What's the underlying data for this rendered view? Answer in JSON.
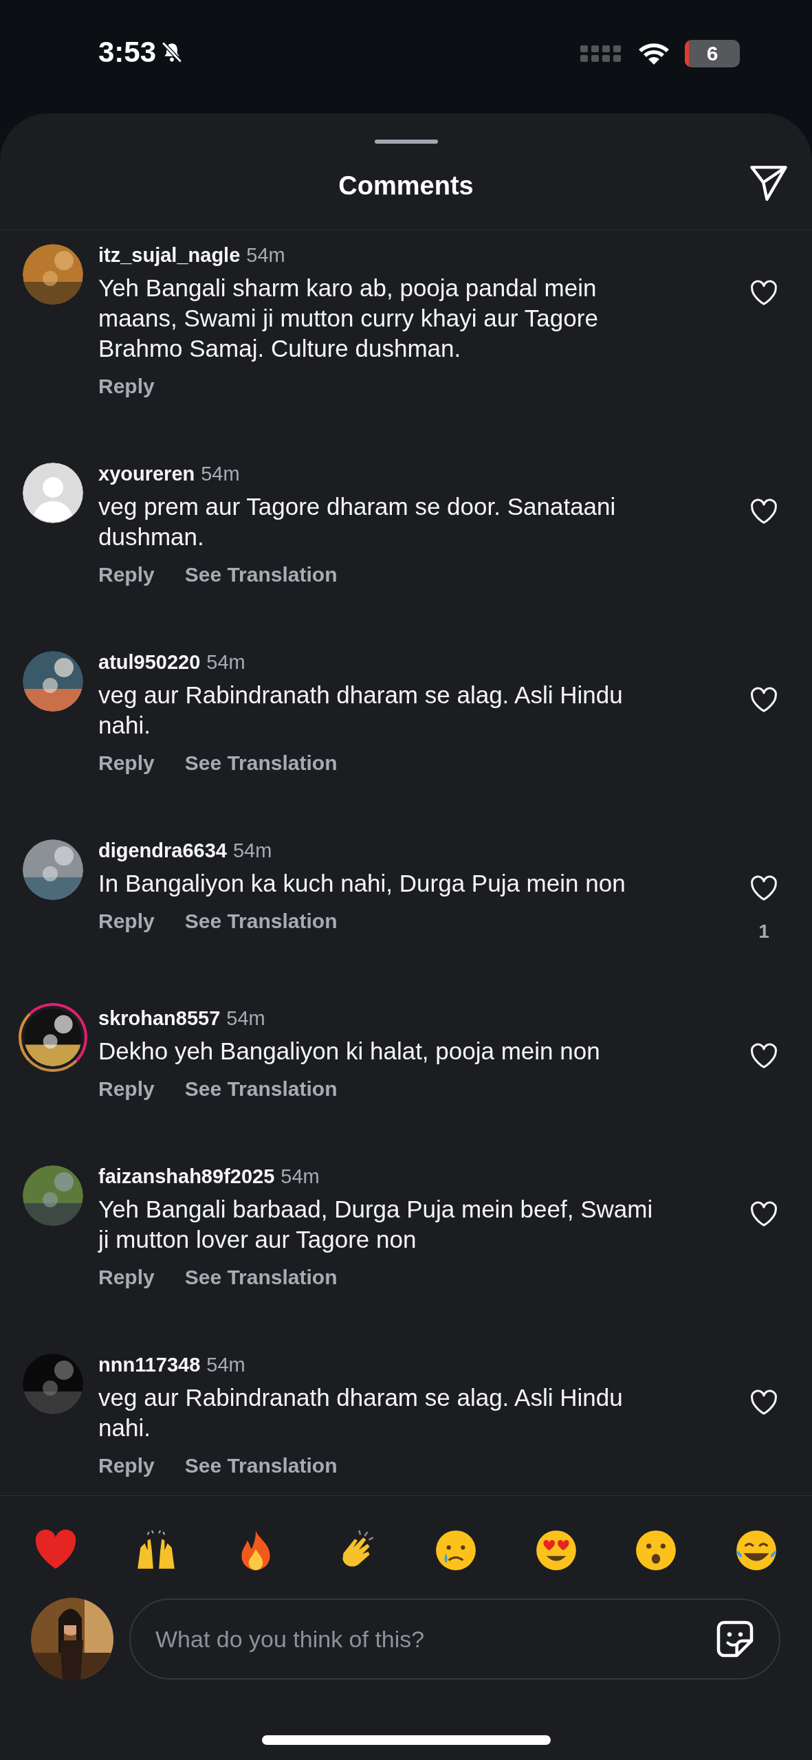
{
  "status_bar": {
    "time": "3:53",
    "battery": "6"
  },
  "header": {
    "title": "Comments"
  },
  "comments": [
    {
      "username": "itz_sujal_nagle",
      "time": "54m",
      "text": "Yeh Bangali sharm karo ab, pooja pandal mein maans, Swami ji mutton curry khayi aur Tagore Brahmo Samaj. Culture dushman.",
      "avatar": {
        "kind": "picture",
        "story_ring": false
      },
      "liked": false,
      "actions": [
        "Reply"
      ]
    },
    {
      "username": "xyoureren",
      "time": "54m",
      "text": "veg prem aur Tagore dharam se door. Sanataani dushman.",
      "avatar": {
        "kind": "default",
        "story_ring": false
      },
      "liked": false,
      "actions": [
        "Reply",
        "See Translation"
      ]
    },
    {
      "username": "atul950220",
      "time": "54m",
      "text": "veg aur Rabindranath dharam se alag. Asli Hindu nahi.",
      "avatar": {
        "kind": "picture",
        "story_ring": false
      },
      "liked": false,
      "actions": [
        "Reply",
        "See Translation"
      ]
    },
    {
      "username": "digendra6634",
      "time": "54m",
      "text": "In Bangaliyon ka kuch nahi, Durga Puja mein non",
      "avatar": {
        "kind": "picture",
        "story_ring": false
      },
      "liked": false,
      "like_count": "1",
      "actions": [
        "Reply",
        "See Translation"
      ]
    },
    {
      "username": "skrohan8557",
      "time": "54m",
      "text": "Dekho yeh Bangaliyon ki halat, pooja mein non",
      "avatar": {
        "kind": "picture",
        "story_ring": true
      },
      "liked": false,
      "actions": [
        "Reply",
        "See Translation"
      ]
    },
    {
      "username": "faizanshah89f2025",
      "time": "54m",
      "text": "Yeh Bangali barbaad, Durga Puja mein beef, Swami ji mutton lover aur Tagore non",
      "avatar": {
        "kind": "picture",
        "story_ring": false
      },
      "liked": false,
      "actions": [
        "Reply",
        "See Translation"
      ]
    },
    {
      "username": "nnn117348",
      "time": "54m",
      "text": "veg aur Rabindranath dharam se alag. Asli Hindu nahi.",
      "avatar": {
        "kind": "picture",
        "story_ring": false
      },
      "liked": false,
      "actions": [
        "Reply",
        "See Translation"
      ]
    }
  ],
  "composer": {
    "placeholder": "What do you think of this?"
  }
}
